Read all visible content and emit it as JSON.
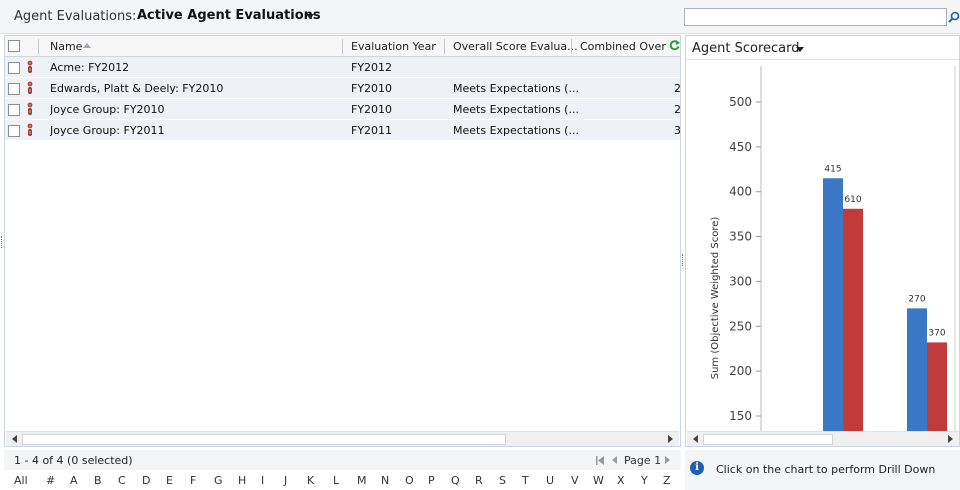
{
  "header": {
    "view_label": "Agent Evaluations:",
    "view_name": "Active Agent Evaluations",
    "search": {
      "value": "",
      "placeholder": ""
    }
  },
  "grid": {
    "columns": [
      "Name",
      "Evaluation Year",
      "Overall Score Evalua...",
      "Combined Overa"
    ],
    "rows": [
      {
        "name": "Acme: FY2012",
        "year": "FY2012",
        "overall": "",
        "combined": ""
      },
      {
        "name": "Edwards, Platt & Deely: FY2010",
        "year": "FY2010",
        "overall": "Meets Expectations (...",
        "combined": "2"
      },
      {
        "name": "Joyce Group: FY2010",
        "year": "FY2010",
        "overall": "Meets Expectations (...",
        "combined": "2"
      },
      {
        "name": "Joyce Group: FY2011",
        "year": "FY2011",
        "overall": "Meets Expectations (...",
        "combined": "3"
      }
    ],
    "status": "1 - 4 of 4 (0 selected)",
    "page_label": "Page 1",
    "alphabet": [
      "All",
      "#",
      "A",
      "B",
      "C",
      "D",
      "E",
      "F",
      "G",
      "H",
      "I",
      "J",
      "K",
      "L",
      "M",
      "N",
      "O",
      "P",
      "Q",
      "R",
      "S",
      "T",
      "U",
      "V",
      "W",
      "X",
      "Y",
      "Z"
    ]
  },
  "chart_pane": {
    "title": "Agent Scorecard",
    "info": "Click on the chart to perform Drill Down"
  },
  "colors": {
    "series_blue": "#3a78c6",
    "series_red": "#c23b3b",
    "refresh_green": "#2e9d3e"
  },
  "chart_data": {
    "type": "bar",
    "ylabel": "Sum (Objective Weighted Score)",
    "y_ticks": [
      150,
      200,
      250,
      300,
      350,
      400,
      450,
      500
    ],
    "ylim": [
      130,
      510
    ],
    "groups": [
      {
        "values": [
          415,
          381
        ],
        "labels": [
          "415",
          "610"
        ]
      },
      {
        "values": [
          270,
          232
        ],
        "labels": [
          "270",
          "370"
        ]
      }
    ],
    "grid": false
  }
}
